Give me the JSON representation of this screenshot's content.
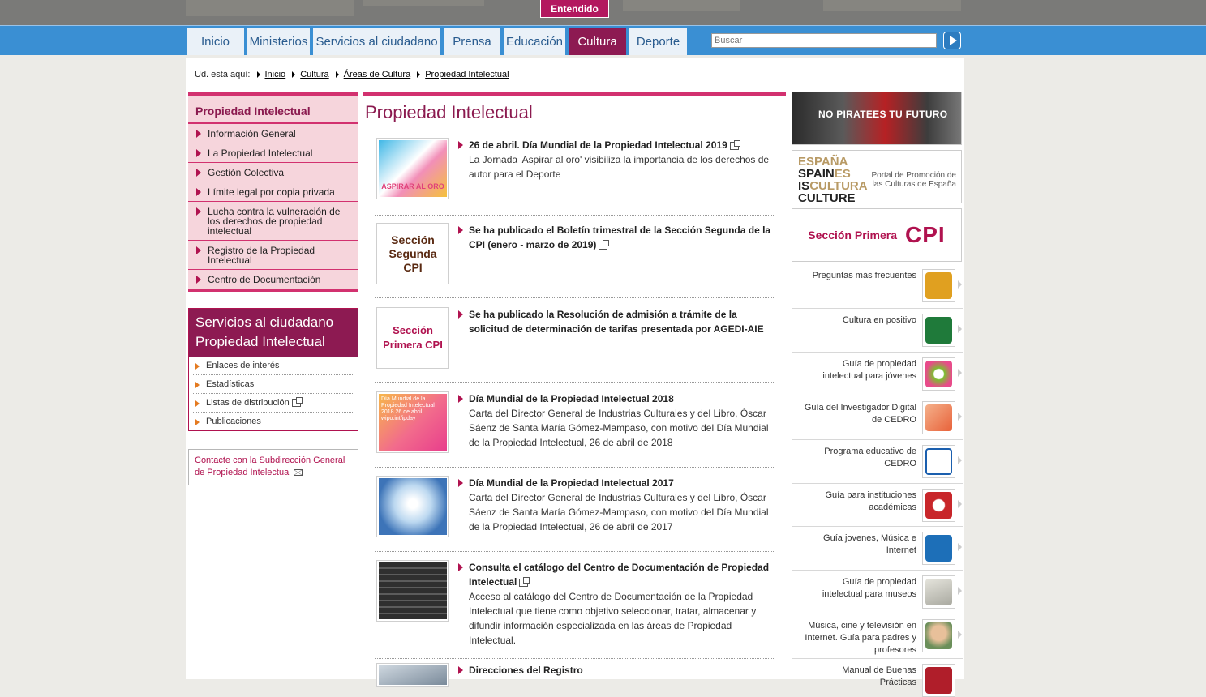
{
  "cookie": {
    "accept_label": "Entendido"
  },
  "nav": {
    "tabs": [
      "Inicio",
      "Ministerios",
      "Servicios al ciudadano",
      "Prensa",
      "Educación",
      "Cultura",
      "Deporte"
    ],
    "active": "Cultura",
    "search_placeholder": "Buscar"
  },
  "breadcrumb": {
    "prefix": "Ud. está aquí:",
    "items": [
      "Inicio",
      "Cultura",
      "Áreas de Cultura",
      "Propiedad Intelectual"
    ]
  },
  "leftnav": {
    "title": "Propiedad Intelectual",
    "items": [
      "Información General",
      "La Propiedad Intelectual",
      "Gestión Colectiva",
      "Límite legal por copia privada",
      "Lucha contra la vulneración de los derechos de propiedad intelectual",
      "Registro de la Propiedad Intelectual",
      "Centro de Documentación"
    ]
  },
  "services": {
    "title": "Servicios al ciudadano Propiedad Intelectual",
    "items": [
      "Enlaces de interés",
      "Estadísticas",
      "Listas de distribución",
      "Publicaciones"
    ]
  },
  "contact": {
    "text": "Contacte con la Subdirección General de Propiedad Intelectual"
  },
  "main": {
    "title": "Propiedad Intelectual",
    "news": [
      {
        "title": "26 de abril. Día Mundial de la Propiedad Intelectual 2019",
        "body": "La Jornada 'Aspirar al oro' visibiliza la importancia de los derechos de autor para el Deporte",
        "external": true,
        "thumb_text": "ASPIRAR AL ORO"
      },
      {
        "title": "Se ha publicado el Boletín trimestral de la Sección Segunda de la CPI (enero - marzo de 2019)",
        "body": "",
        "external": true,
        "thumb_text": "Sección Segunda CPI"
      },
      {
        "title": "Se ha publicado la Resolución de admisión a trámite de la solicitud de determinación de tarifas presentada por AGEDI-AIE",
        "body": "",
        "external": false,
        "thumb_text": "Sección Primera CPI"
      },
      {
        "title": "Día Mundial de la Propiedad Intelectual 2018",
        "body": "Carta del Director General de Industrias Culturales y del Libro, Óscar Sáenz de Santa María Gómez-Mampaso, con motivo del Día Mundial de la Propiedad Intelectual, 26 de abril de 2018",
        "external": false,
        "thumb_text": "Día Mundial de la Propiedad Intelectual 2018 26 de abril wipo.int/ipday"
      },
      {
        "title": "Día Mundial de la Propiedad Intelectual 2017",
        "body": "Carta del Director General de Industrias Culturales y del Libro, Óscar Sáenz de Santa María Gómez-Mampaso, con motivo del Día Mundial de la Propiedad Intelectual, 26 de abril de 2017",
        "external": false,
        "thumb_text": ""
      },
      {
        "title": "Consulta el catálogo del Centro de Documentación de Propiedad Intelectual",
        "body": "Acceso al catálogo del Centro de Documentación de la Propiedad Intelectual que tiene como objetivo seleccionar, tratar, almacenar y difundir información especializada en las áreas de Propiedad Intelectual.",
        "external": true,
        "thumb_text": ""
      },
      {
        "title": "Direcciones del Registro",
        "body": "",
        "external": false,
        "thumb_text": ""
      }
    ]
  },
  "right": {
    "banner1_text": "NO PIRATEES TU FUTURO",
    "banner2_logo": [
      "ESPAÑA",
      "SPAIN",
      "ES",
      "IS",
      "CULTURA",
      "CULTURE"
    ],
    "banner2_caption": "Portal de Promoción de las Culturas de España",
    "banner3_text": "Sección Primera",
    "banner3_abbr": "CPI",
    "links": [
      {
        "label": "Preguntas más frecuentes",
        "icon": "faq-icon",
        "color": "#e0a020"
      },
      {
        "label": "Cultura en positivo",
        "icon": "cultura-positivo-icon",
        "color": "#1f7a3a"
      },
      {
        "label": "Guía de propiedad intelectual para jóvenes",
        "icon": "guia-jovenes-icon",
        "color": "#7bbf2f"
      },
      {
        "label": "Guía del Investigador Digital de CEDRO",
        "icon": "investigador-icon",
        "color": "#e8623a"
      },
      {
        "label": "Programa educativo de CEDRO",
        "icon": "esdelibro-icon",
        "color": "#1b5fae"
      },
      {
        "label": "Guía para instituciones académicas",
        "icon": "instituciones-icon",
        "color": "#c8262a"
      },
      {
        "label": "Guía jovenes, Música e Internet",
        "icon": "headphones-icon",
        "color": "#1d6fb8"
      },
      {
        "label": "Guía de propiedad intelectual para museos",
        "icon": "museos-icon",
        "color": "#a9a9a0"
      },
      {
        "label": "Música, cine y televisión en Internet. Guía para padres y profesores",
        "icon": "padres-icon",
        "color": "#c89060"
      },
      {
        "label": "Manual de Buenas Prácticas",
        "icon": "manual-icon",
        "color": "#b01e2a"
      }
    ]
  }
}
